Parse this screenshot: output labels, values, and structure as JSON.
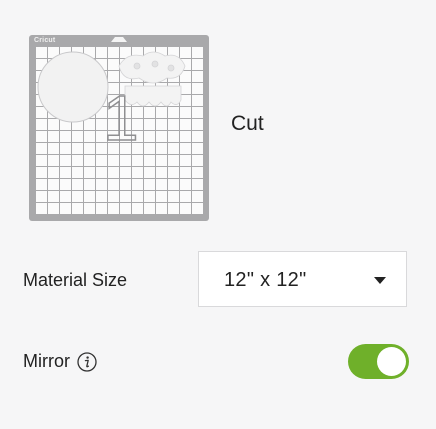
{
  "mat": {
    "brand": "Cricut",
    "mat_number": "1",
    "operation_label": "Cut"
  },
  "material_size": {
    "label": "Material Size",
    "selected": "12\" x 12\""
  },
  "mirror": {
    "label": "Mirror",
    "enabled": true
  },
  "colors": {
    "background": "#f6f6f7",
    "toggle_on": "#6fb02a",
    "mat_frame": "#a9a9ab"
  },
  "icons": {
    "info": "info-icon",
    "dropdown": "caret-down-icon"
  }
}
